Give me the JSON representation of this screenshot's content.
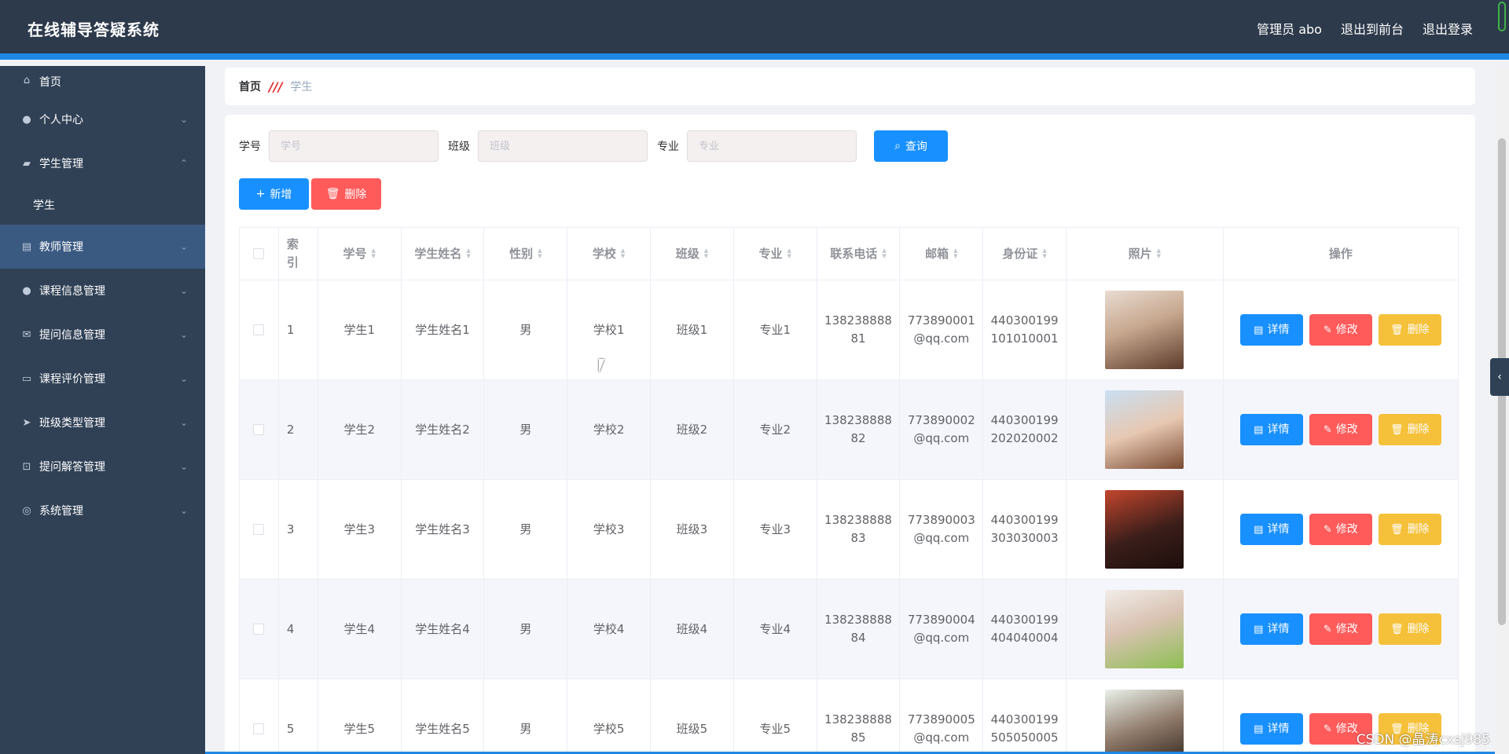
{
  "header": {
    "title": "在线辅导答疑系统",
    "user": "管理员 abo",
    "to_front": "退出到前台",
    "logout": "退出登录"
  },
  "sidebar": {
    "items": [
      {
        "label": "首页",
        "icon": "home-icon"
      },
      {
        "label": "个人中心",
        "icon": "user-icon"
      },
      {
        "label": "学生管理",
        "icon": "folder-icon"
      },
      {
        "label": "学生",
        "icon": ""
      },
      {
        "label": "教师管理",
        "icon": "briefcase-icon"
      },
      {
        "label": "课程信息管理",
        "icon": "user-icon"
      },
      {
        "label": "提问信息管理",
        "icon": "mail-icon"
      },
      {
        "label": "课程评价管理",
        "icon": "chat-icon"
      },
      {
        "label": "班级类型管理",
        "icon": "send-icon"
      },
      {
        "label": "提问解答管理",
        "icon": "crop-icon"
      },
      {
        "label": "系统管理",
        "icon": "settings-icon"
      }
    ]
  },
  "breadcrumb": {
    "home": "首页",
    "separator": "///",
    "current": "学生"
  },
  "search": {
    "student_no_label": "学号",
    "student_no_placeholder": "学号",
    "class_label": "班级",
    "class_placeholder": "班级",
    "major_label": "专业",
    "major_placeholder": "专业",
    "query_label": "查询"
  },
  "actions": {
    "add_label": "新增",
    "delete_label": "删除"
  },
  "table": {
    "headers": [
      "索引",
      "学号",
      "学生姓名",
      "性别",
      "学校",
      "班级",
      "专业",
      "联系电话",
      "邮箱",
      "身份证",
      "照片",
      "操作"
    ],
    "ops": {
      "detail": "详情",
      "edit": "修改",
      "delete": "删除"
    },
    "rows": [
      {
        "idx": "1",
        "no": "学生1",
        "name": "学生姓名1",
        "sex": "男",
        "school": "学校1",
        "cls": "班级1",
        "major": "专业1",
        "phone1": "138238888",
        "phone2": "81",
        "mail1": "773890001",
        "mail2": "@qq.com",
        "id1": "440300199",
        "id2": "101010001"
      },
      {
        "idx": "2",
        "no": "学生2",
        "name": "学生姓名2",
        "sex": "男",
        "school": "学校2",
        "cls": "班级2",
        "major": "专业2",
        "phone1": "138238888",
        "phone2": "82",
        "mail1": "773890002",
        "mail2": "@qq.com",
        "id1": "440300199",
        "id2": "202020002"
      },
      {
        "idx": "3",
        "no": "学生3",
        "name": "学生姓名3",
        "sex": "男",
        "school": "学校3",
        "cls": "班级3",
        "major": "专业3",
        "phone1": "138238888",
        "phone2": "83",
        "mail1": "773890003",
        "mail2": "@qq.com",
        "id1": "440300199",
        "id2": "303030003"
      },
      {
        "idx": "4",
        "no": "学生4",
        "name": "学生姓名4",
        "sex": "男",
        "school": "学校4",
        "cls": "班级4",
        "major": "专业4",
        "phone1": "138238888",
        "phone2": "84",
        "mail1": "773890004",
        "mail2": "@qq.com",
        "id1": "440300199",
        "id2": "404040004"
      },
      {
        "idx": "5",
        "no": "学生5",
        "name": "学生姓名5",
        "sex": "男",
        "school": "学校5",
        "cls": "班级5",
        "major": "专业5",
        "phone1": "138238888",
        "phone2": "85",
        "mail1": "773890005",
        "mail2": "@qq.com",
        "id1": "440300199",
        "id2": "505050005"
      }
    ]
  },
  "watermark": "CSDN @晶涛cxsj985",
  "colors": {
    "header_bg": "#2d3a4b",
    "sidebar_bg": "#304156",
    "primary": "#1890ff",
    "danger": "#ff5b5b",
    "warning": "#f5c13a"
  }
}
